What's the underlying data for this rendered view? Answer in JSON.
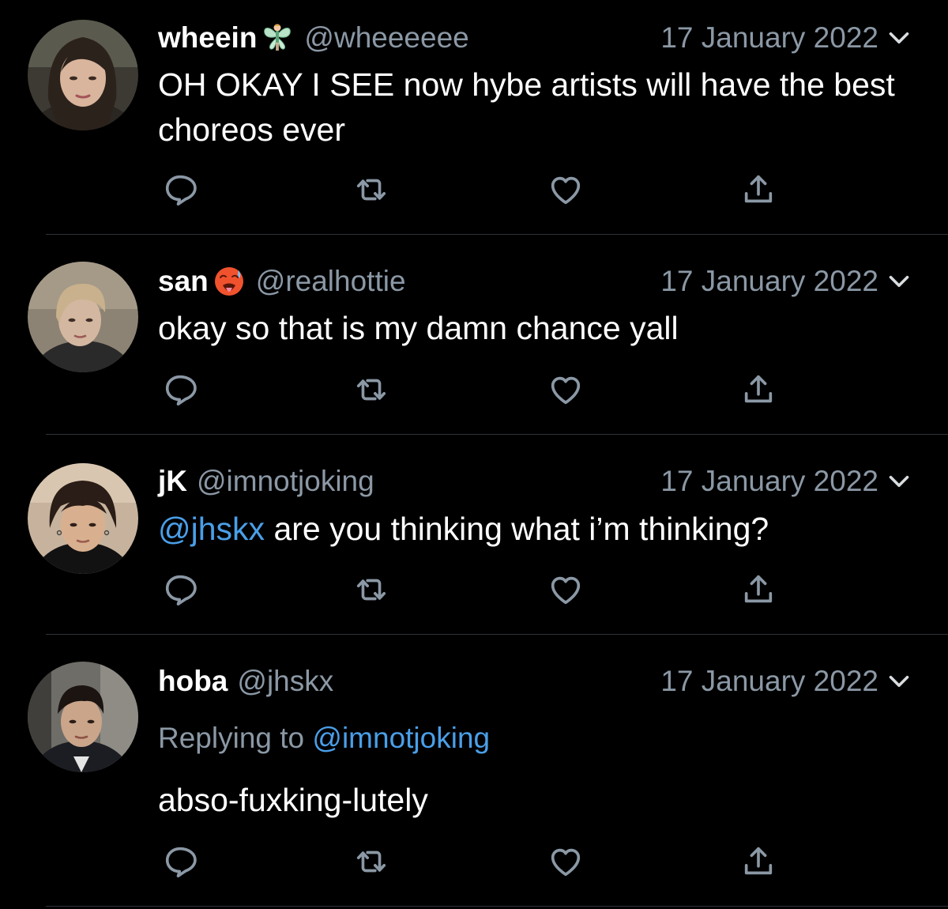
{
  "theme": {
    "background": "#000000",
    "text": "#ffffff",
    "secondary_text": "#8b98a5",
    "accent": "#4a9fe8",
    "divider": "#2f3336"
  },
  "tweets": [
    {
      "display_name": "wheein",
      "name_emoji": "fairy",
      "handle": "@wheeeeee",
      "date": "17 January 2022",
      "text": "OH OKAY I SEE now hybe artists will have the best choreos ever",
      "actions": [
        "reply-icon",
        "retweet-icon",
        "like-icon",
        "share-icon"
      ]
    },
    {
      "display_name": "san",
      "name_emoji": "hot-face",
      "handle": "@realhottie",
      "date": "17 January 2022",
      "text": "okay so that is my damn chance yall",
      "actions": [
        "reply-icon",
        "retweet-icon",
        "like-icon",
        "share-icon"
      ]
    },
    {
      "display_name": "jK",
      "handle": "@imnotjoking",
      "date": "17 January 2022",
      "mention": "@jhskx",
      "text": " are you thinking what i’m thinking?",
      "actions": [
        "reply-icon",
        "retweet-icon",
        "like-icon",
        "share-icon"
      ]
    },
    {
      "display_name": "hoba",
      "handle": "@jhskx",
      "date": "17 January 2022",
      "replying_to_label": "Replying to",
      "replying_to_handle": "@imnotjoking",
      "text": "abso-fuxking-lutely",
      "actions": [
        "reply-icon",
        "retweet-icon",
        "like-icon",
        "share-icon"
      ]
    }
  ]
}
